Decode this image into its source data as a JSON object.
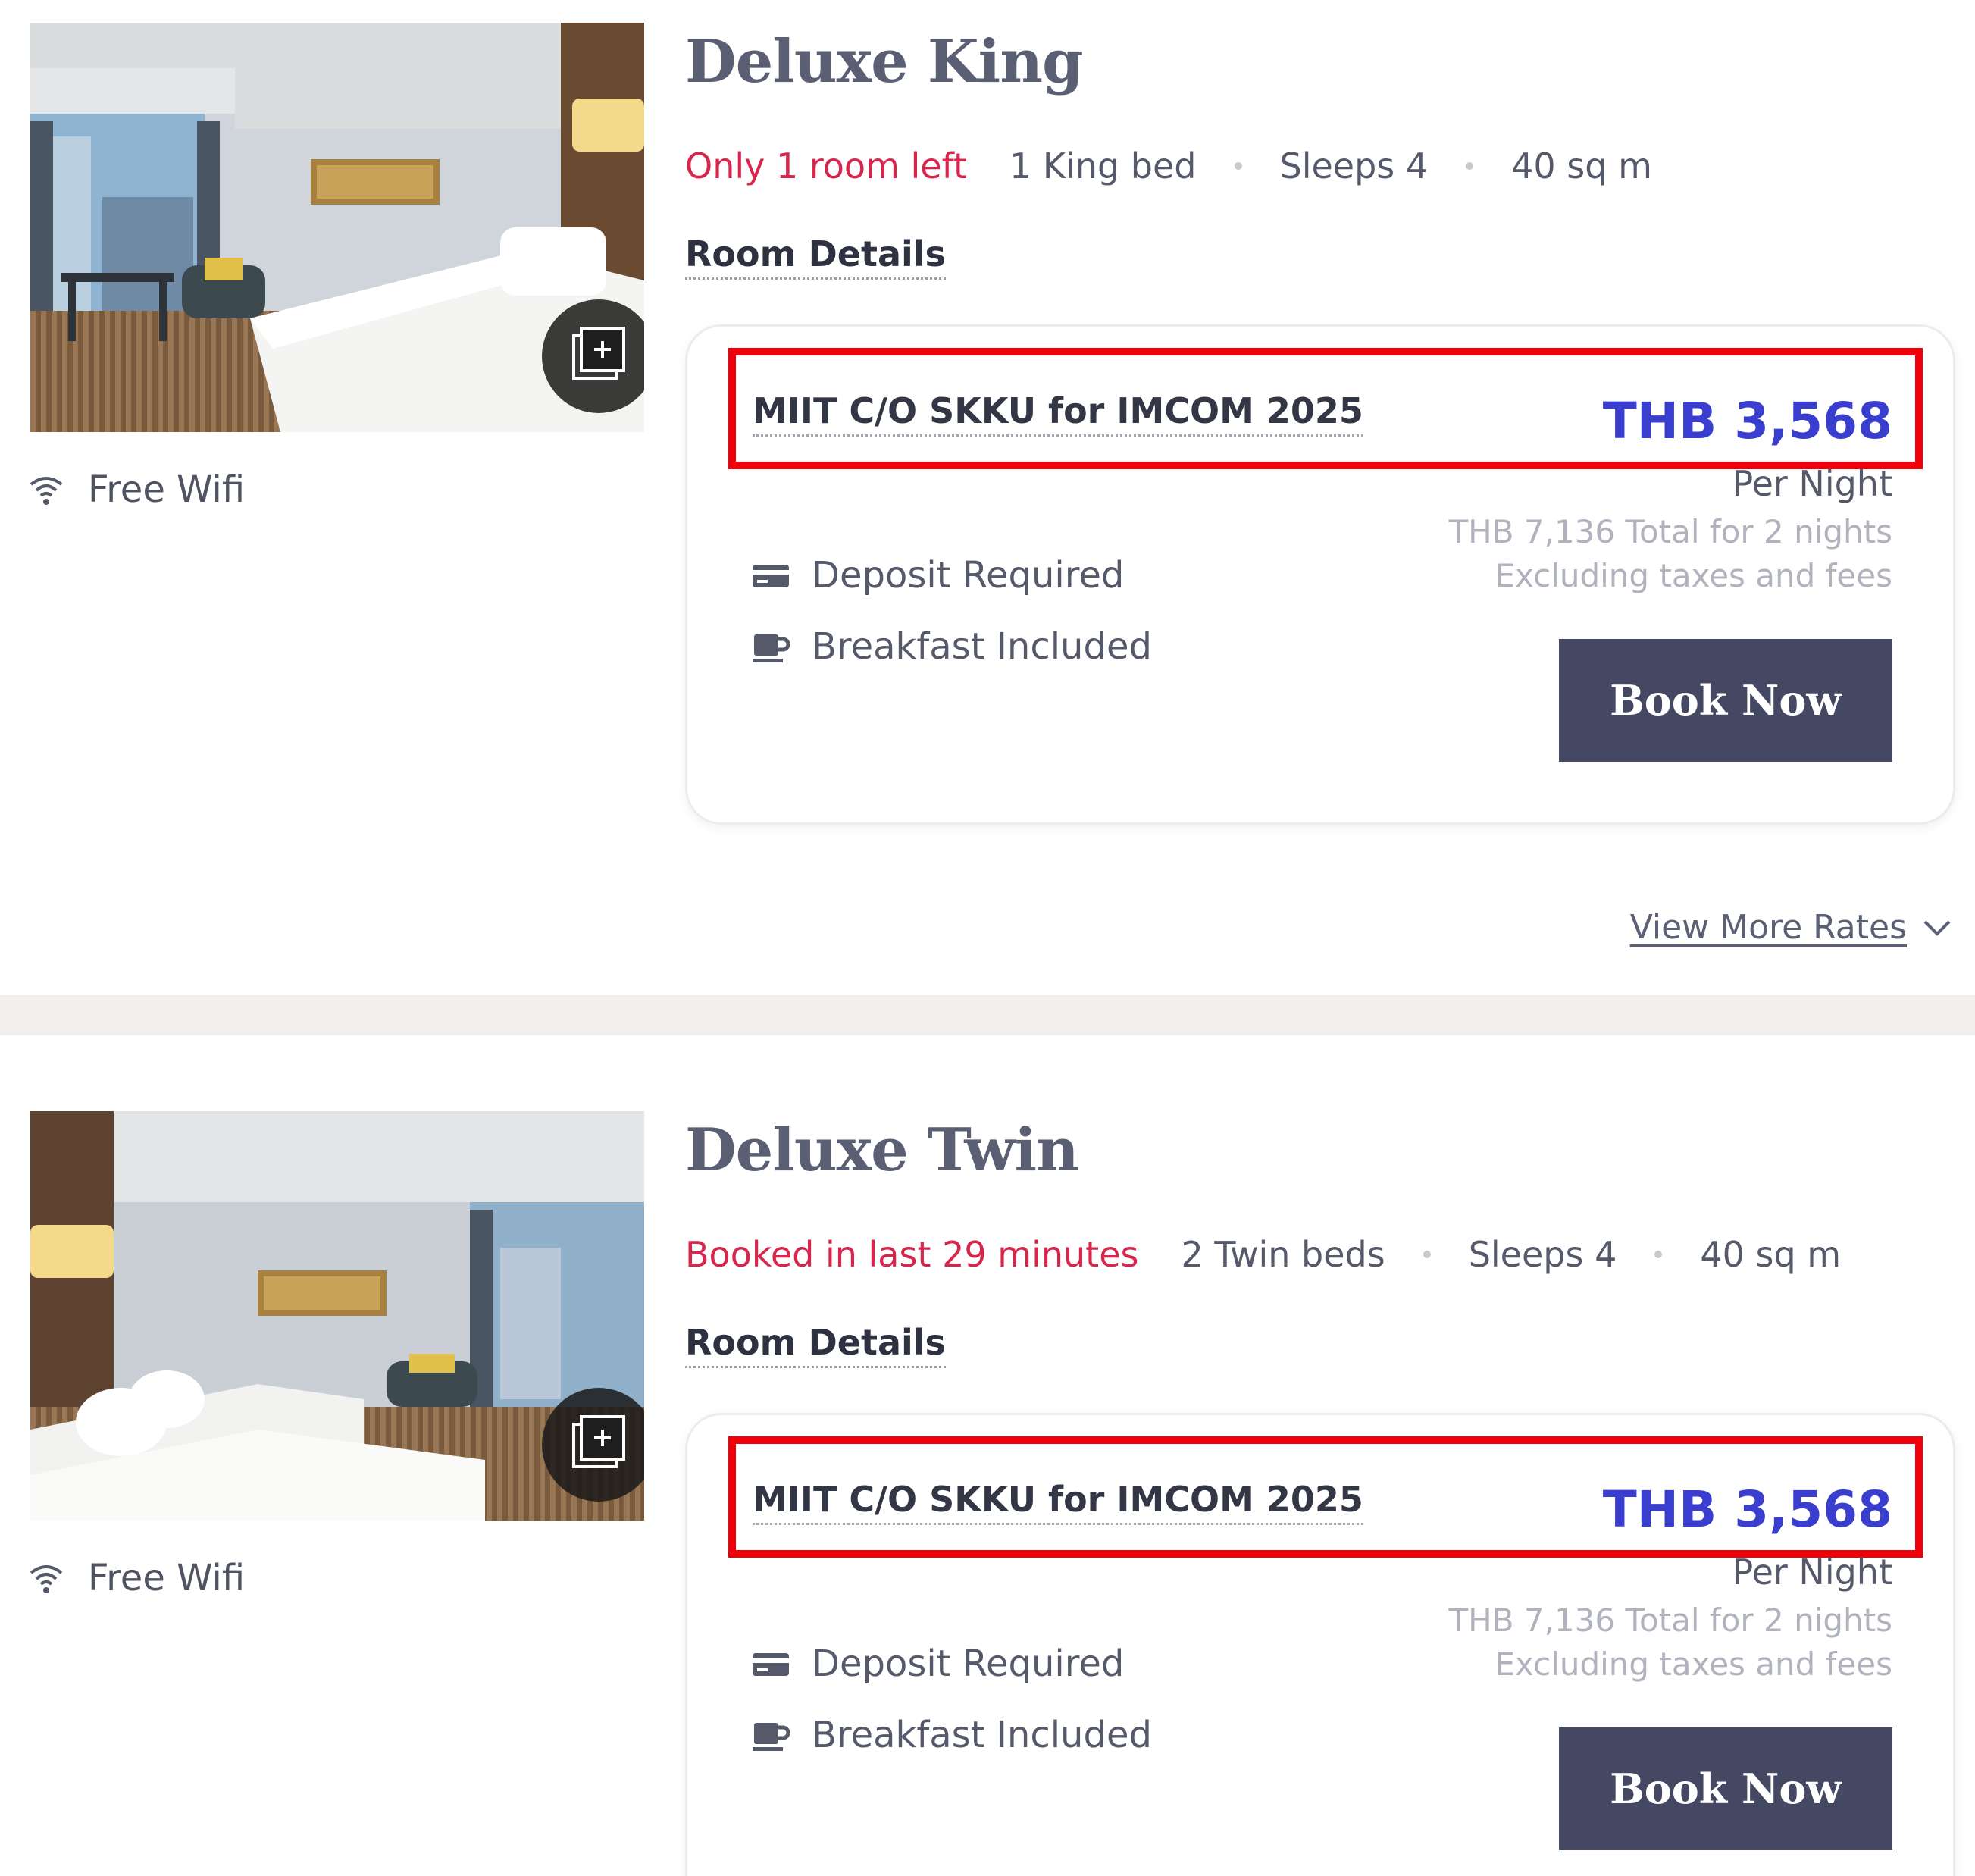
{
  "rooms": [
    {
      "title": "Deluxe King",
      "urgency": "Only 1 room left",
      "bed": "1 King bed",
      "sleeps": "Sleeps 4",
      "size": "40 sq m",
      "details_label": "Room Details",
      "amenity": "Free Wifi",
      "rate": {
        "name": "MIIT C/O SKKU for IMCOM 2025",
        "price": "THB 3,568",
        "per": "Per Night",
        "total": "THB 7,136 Total for 2 nights",
        "excl": "Excluding taxes and fees",
        "features": [
          "Deposit Required",
          "Breakfast Included"
        ],
        "book_label": "Book Now"
      },
      "more_rates": "View More Rates"
    },
    {
      "title": "Deluxe Twin",
      "urgency": "Booked in last 29 minutes",
      "bed": "2 Twin beds",
      "sleeps": "Sleeps 4",
      "size": "40 sq m",
      "details_label": "Room Details",
      "amenity": "Free Wifi",
      "rate": {
        "name": "MIIT C/O SKKU for IMCOM 2025",
        "price": "THB 3,568",
        "per": "Per Night",
        "total": "THB 7,136 Total for 2 nights",
        "excl": "Excluding taxes and fees",
        "features": [
          "Deposit Required",
          "Breakfast Included"
        ],
        "book_label": "Book Now"
      }
    }
  ],
  "icons": {
    "gallery": "gallery-expand-icon",
    "wifi": "wifi-icon",
    "card": "credit-card-icon",
    "cup": "coffee-cup-icon",
    "chevron": "chevron-down-icon"
  },
  "colors": {
    "urgent": "#d8254c",
    "price": "#3a3ecf",
    "button": "#454863",
    "highlight": "#f0000a"
  }
}
